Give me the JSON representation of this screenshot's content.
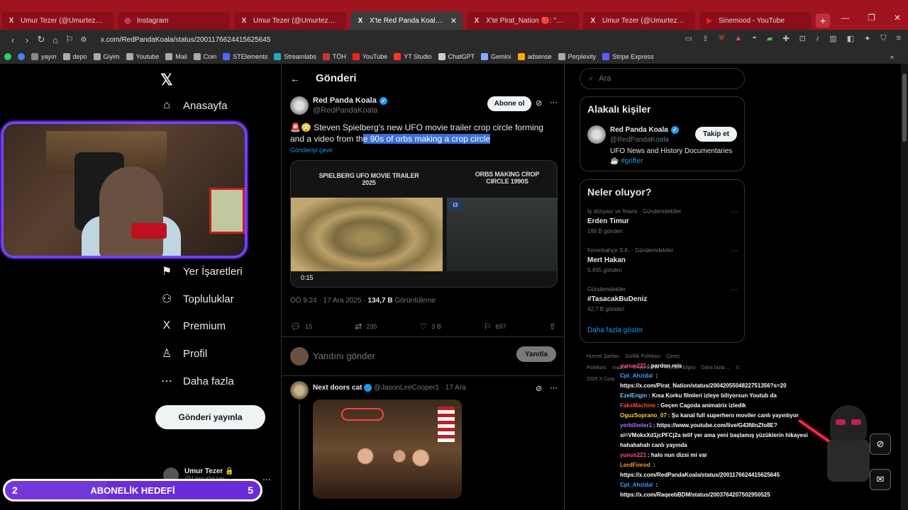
{
  "browser": {
    "tabs": [
      {
        "label": "Umur Tezer (@Umurtezer) / X",
        "icon": "X",
        "active": false
      },
      {
        "label": "Instagram",
        "icon": "◎",
        "active": false
      },
      {
        "label": "Umur Tezer (@Umurtezer) / X",
        "icon": "X",
        "active": false
      },
      {
        "label": "X'te Red Panda Koala: \"🚨😳 St",
        "icon": "X",
        "active": true
      },
      {
        "label": "X'te Pirat_Nation 🔴: \"Mr. House in",
        "icon": "X",
        "active": false
      },
      {
        "label": "Umur Tezer (@Umurtezer) / X",
        "icon": "X",
        "active": false
      },
      {
        "label": "Sinemood - YouTube",
        "icon": "▶",
        "active": false
      }
    ],
    "url": "x.com/RedPandaKoala/status/2001176624415625645",
    "bookmarks": [
      "yayın",
      "depo",
      "Giyim",
      "Youtube",
      "Mail",
      "Coin",
      "STElements",
      "Streamlabs",
      "TÖH",
      "YouTube",
      "YT Studio",
      "ChatGPT",
      "Gemini",
      "adsense",
      "Perplexity",
      "Stripe Express"
    ]
  },
  "nav": {
    "items": [
      {
        "label": "Anasayfa",
        "icon": "⌂"
      },
      {
        "label": "Yer İşaretleri",
        "icon": "⚑"
      },
      {
        "label": "Topluluklar",
        "icon": "⚇"
      },
      {
        "label": "Premium",
        "icon": "X"
      },
      {
        "label": "Profil",
        "icon": "♙"
      },
      {
        "label": "Daha fazla",
        "icon": "⋯"
      }
    ],
    "post_button": "Gönderi yayınla",
    "account_name": "Umur Tezer 🔒",
    "account_handle": "@Umurtezer"
  },
  "tweet": {
    "header": "Gönderi",
    "name": "Red Panda Koala",
    "handle": "@RedPandaKoala",
    "subscribe": "Abone ol",
    "text_before": "🚨😳 Steven Spielberg's new UFO movie trailer crop circle forming and a video from th",
    "text_highlight": "e 90s of orbs making a crop circle",
    "translate": "Gönderiyi çevir",
    "media": {
      "left_label": "SPIELBERG UFO MOVIE TRAILER 2025",
      "right_label": "ORBS MAKING CROP CIRCLE 1990S",
      "badge": "I3",
      "duration": "0:15"
    },
    "meta_time": "ÖÖ 9:24 · 17 Ara 2025 · ",
    "meta_views": "134,7 B",
    "meta_views_label": " Görüntüleme",
    "replies": "15",
    "reposts": "235",
    "likes": "3 B",
    "bookmarks": "697",
    "reply_placeholder": "Yanıtını gönder",
    "reply_button": "Yanıtla"
  },
  "next_tweet": {
    "name": "Next doors cat",
    "handle_time": "@JasonLeeCooper1 · 17 Ara"
  },
  "right": {
    "search_placeholder": "Ara",
    "related_title": "Alakalı kişiler",
    "related": {
      "name": "Red Panda Koala",
      "handle": "@RedPandaKoala",
      "bio": "UFO News and History Documentaries",
      "bio_tag": "☕ #grifter",
      "follow": "Takip et"
    },
    "trends_title": "Neler oluyor?",
    "trends": [
      {
        "context": "İş dünyası ve finans · Gündemdekiler",
        "title": "Erden Timur",
        "count": "166 B gönderi"
      },
      {
        "context": "Fenerbahçe S.K. · Gündemdekiler",
        "title": "Mert Hakan",
        "count": "5.455 gönderi"
      },
      {
        "context": "Gündemdekiler",
        "title": "#TasacakBuDeniz",
        "count": "42,7 B gönderi"
      }
    ],
    "show_more": "Daha fazla göster",
    "footer": [
      "Hizmet Şartları",
      "Gizlilik Politikası",
      "Çerez Politikası",
      "Imprint",
      "Erişilebilirlik",
      "Reklam bilgisi",
      "Daha fazla ...",
      "© 2025 X Corp."
    ]
  },
  "chat": [
    {
      "user": "yunus221",
      "color": "#ff5090",
      "text": ": pardon reis"
    },
    {
      "user": "Cpt_Ahzidal",
      "color": "#3aa0ff",
      "text": " :"
    },
    {
      "user": "",
      "color": "#fff",
      "text": "https://x.com/Pirat_Nation/status/2004205504822751356?s=20"
    },
    {
      "user": "EzelEngin",
      "color": "#5fd0ff",
      "text": ": Kısa Korku filmleri izleye biliyorsun Youtub da"
    },
    {
      "user": "FaksMachine",
      "color": "#ff4a4a",
      "text": ": Geçen Cagoda animatrix izledik"
    },
    {
      "user": "OguzSoprano_07",
      "color": "#ffd030",
      "text": ": Şu kanal full superhero moviler canlı yayınlıyor"
    },
    {
      "user": "yerbilimler1",
      "color": "#b070ff",
      "text": ": https://www.youtube.com/live/G43NInZfo8E?"
    },
    {
      "user": "",
      "color": "#fff",
      "text": "si=VMokxXd1jcPFCj2a telif yer ama yeni başlamış yüzüklerin hikayesi"
    },
    {
      "user": "",
      "color": "#fff",
      "text": "hahahahah canlı yayında"
    },
    {
      "user": "yunus221",
      "color": "#ff5090",
      "text": ": halo nun dizsi mi var"
    },
    {
      "user": "LordFinrod",
      "color": "#ffa030",
      "text": " :"
    },
    {
      "user": "",
      "color": "#fff",
      "text": "https://x.com/RedPandaKoala/status/2001176624415625645"
    },
    {
      "user": "Cpt_Ahzidal",
      "color": "#3aa0ff",
      "text": " :"
    },
    {
      "user": "",
      "color": "#fff",
      "text": "https://x.com/RaqeebBDM/status/2003764207502950525"
    }
  ],
  "goal": {
    "current": "2",
    "label": "ABONELİK HEDEFİ",
    "target": "5",
    "progress": 0.4
  },
  "colors": {
    "accent": "#1d9bf0",
    "tabbar": "#a01420",
    "goal": "#6a2cd8",
    "webcam_border": "#7b44ff"
  }
}
